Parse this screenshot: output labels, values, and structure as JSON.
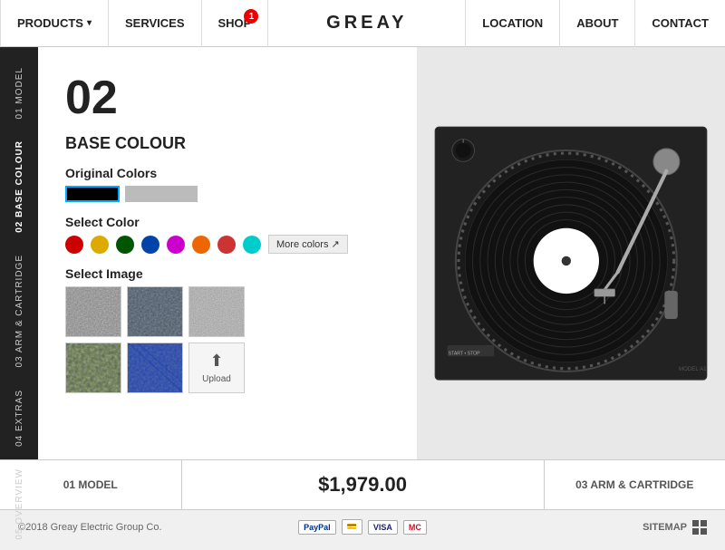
{
  "nav": {
    "items_left": [
      {
        "label": "PRODUCTS",
        "has_caret": true
      },
      {
        "label": "SERVICES",
        "has_caret": false
      },
      {
        "label": "SHOP",
        "has_caret": false,
        "badge": "1"
      }
    ],
    "logo": "GREAY",
    "items_right": [
      {
        "label": "LOCATION"
      },
      {
        "label": "ABOUT"
      },
      {
        "label": "CONTACT"
      }
    ]
  },
  "sidebar": {
    "items": [
      {
        "label": "01 MODEL",
        "active": false
      },
      {
        "label": "02 BASE COLOUR",
        "active": true
      },
      {
        "label": "03 ARM & CARTRIDGE",
        "active": false
      },
      {
        "label": "04 EXTRAS",
        "active": false
      },
      {
        "label": "05 OVERVIEW",
        "active": false
      }
    ]
  },
  "main": {
    "step_number": "02",
    "step_title": "BASE COLOUR",
    "original_colors_label": "Original Colors",
    "select_color_label": "Select Color",
    "select_image_label": "Select Image",
    "more_colors_label": "More colors",
    "upload_label": "Upload",
    "colors": [
      {
        "hex": "#cc0000",
        "name": "red"
      },
      {
        "hex": "#ddaa00",
        "name": "yellow"
      },
      {
        "hex": "#005500",
        "name": "dark-green"
      },
      {
        "hex": "#0044aa",
        "name": "blue"
      },
      {
        "hex": "#cc00cc",
        "name": "magenta"
      },
      {
        "hex": "#ee6600",
        "name": "orange"
      },
      {
        "hex": "#cc3333",
        "name": "coral"
      },
      {
        "hex": "#00cccc",
        "name": "cyan"
      }
    ]
  },
  "bottom": {
    "prev_label": "01 MODEL",
    "price": "$1,979.00",
    "next_label": "03 ARM & CARTRIDGE"
  },
  "footer": {
    "copyright": "©2018 Greay Electric Group Co.",
    "sitemap_label": "SITEMAP"
  }
}
